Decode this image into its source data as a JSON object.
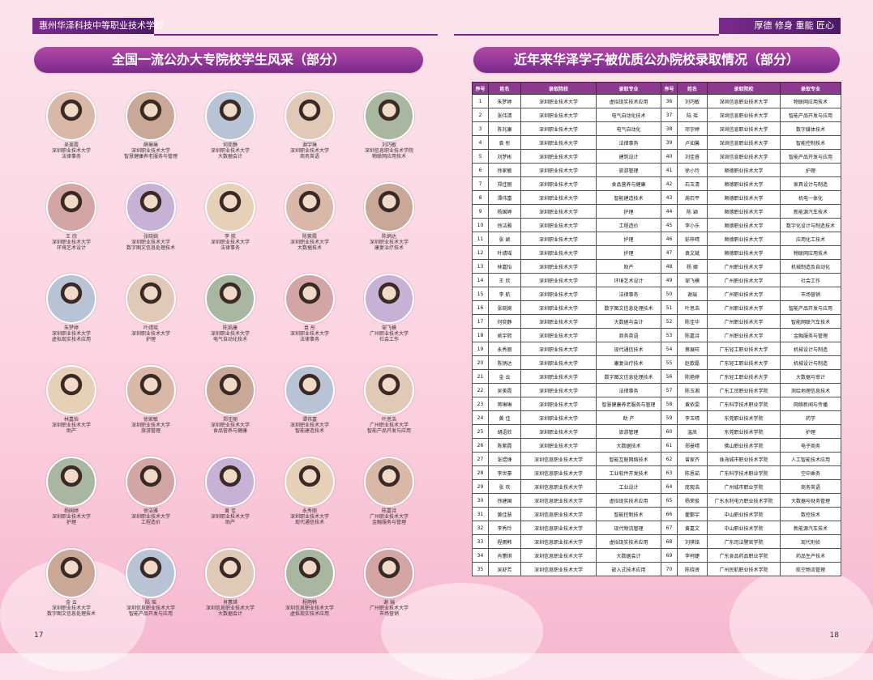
{
  "header": {
    "school": "惠州华泽科技中等职业技术学校",
    "motto": "厚德  修身  重能  匠心"
  },
  "left_title": "全国一流公办大专院校学生风采（部分）",
  "right_title": "近年来华泽学子被优质公办院校录取情况（部分）",
  "students": [
    {
      "name": "吴美霞",
      "school": "深圳职业技术大学",
      "major": "法律事务"
    },
    {
      "name": "薛琳琳",
      "school": "深圳职业技术大学",
      "major": "智慧健康养老服务与管理"
    },
    {
      "name": "何奕静",
      "school": "深圳职业技术大学",
      "major": "大数据会计"
    },
    {
      "name": "谢宇琳",
      "school": "深圳职业技术大学",
      "major": "商务英语"
    },
    {
      "name": "刘巧敏",
      "school": "深圳信息职业技术学院",
      "major": "物联网应用技术"
    },
    {
      "name": "王 欣",
      "school": "深圳职业技术大学",
      "major": "环境艺术设计"
    },
    {
      "name": "张晓婉",
      "school": "深圳职业技术大学",
      "major": "数字图文信息处理技术"
    },
    {
      "name": "李 航",
      "school": "深圳职业技术大学",
      "major": "法律事务"
    },
    {
      "name": "陈紫霞",
      "school": "深圳职业技术大学",
      "major": "大数据技术"
    },
    {
      "name": "陈炳达",
      "school": "深圳职业技术大学",
      "major": "康复治疗技术"
    },
    {
      "name": "朱梦婷",
      "school": "深圳职业技术大学",
      "major": "虚拟现实技术应用"
    },
    {
      "name": "叶靖瑶",
      "school": "深圳职业技术大学",
      "major": "护理"
    },
    {
      "name": "陈焰康",
      "school": "深圳职业技术大学",
      "major": "电气自动化技术"
    },
    {
      "name": "袁 彤",
      "school": "深圳职业技术大学",
      "major": "法律事务"
    },
    {
      "name": "邹飞模",
      "school": "广州职业技术大学",
      "major": "社会工作"
    },
    {
      "name": "林嘉怡",
      "school": "深圳职业技术大学",
      "major": "助产"
    },
    {
      "name": "徐家敏",
      "school": "深圳职业技术大学",
      "major": "旅游管理"
    },
    {
      "name": "郑佳丽",
      "school": "深圳职业技术大学",
      "major": "食品营养与健康"
    },
    {
      "name": "谭伟富",
      "school": "深圳职业技术大学",
      "major": "智能建造技术"
    },
    {
      "name": "叶思浩",
      "school": "广州职业技术大学",
      "major": "智能产品开发与应用"
    },
    {
      "name": "杨国婷",
      "school": "深圳职业技术大学",
      "major": "护理"
    },
    {
      "name": "徐洁雅",
      "school": "深圳职业技术大学",
      "major": "工程造价"
    },
    {
      "name": "黄 佳",
      "school": "深圳职业技术大学",
      "major": "助产"
    },
    {
      "name": "永秀丽",
      "school": "深圳职业技术大学",
      "major": "现代通信技术"
    },
    {
      "name": "陈嘉诗",
      "school": "广州职业技术大学",
      "major": "金融服务与管理"
    },
    {
      "name": "金 云",
      "school": "深圳职业技术大学",
      "major": "数字图文信息处理技术"
    },
    {
      "name": "陆 瑶",
      "school": "深圳信息职业技术大学",
      "major": "智能产品开发与应用"
    },
    {
      "name": "肖蕙琪",
      "school": "深圳信息职业技术大学",
      "major": "大数据会计"
    },
    {
      "name": "程雨韩",
      "school": "深圳信息职业技术大学",
      "major": "虚拟现实技术应用"
    },
    {
      "name": "谢 瑞",
      "school": "广州职业技术大学",
      "major": "市场营销"
    }
  ],
  "table": {
    "headers": [
      "序号",
      "姓名",
      "录取院校",
      "录取专业",
      "序号",
      "姓名",
      "录取院校",
      "录取专业"
    ],
    "rows": [
      [
        "1",
        "朱梦婷",
        "深圳职业技术大学",
        "虚拟现实技术应用",
        "36",
        "刘巧敏",
        "深圳信息职业技术大学",
        "物联网应用技术"
      ],
      [
        "2",
        "张伟清",
        "深圳职业技术大学",
        "电气自动化技术",
        "37",
        "陆 瑶",
        "深圳信息职业技术大学",
        "智能产品开发与应用"
      ],
      [
        "3",
        "陈兆康",
        "深圳职业技术大学",
        "电气自动化",
        "38",
        "邓宇婷",
        "深圳信息职业技术大学",
        "数字媒体技术"
      ],
      [
        "4",
        "袁 彤",
        "深圳职业技术大学",
        "法律事务",
        "39",
        "卢如馨",
        "深圳信息职业技术大学",
        "智能控制技术"
      ],
      [
        "5",
        "刘梦彬",
        "深圳职业技术大学",
        "建筑设计",
        "40",
        "刘佳睿",
        "深圳信息职业技术大学",
        "智能产品开发与应用"
      ],
      [
        "6",
        "徐家敏",
        "深圳职业技术大学",
        "旅游管理",
        "41",
        "徐小玲",
        "顺德职业技术大学",
        "护理"
      ],
      [
        "7",
        "郑佳丽",
        "深圳职业技术大学",
        "食品营养与健康",
        "42",
        "石玉清",
        "顺德职业技术大学",
        "家具设计与制造"
      ],
      [
        "8",
        "谭伟富",
        "深圳职业技术大学",
        "智能建造技术",
        "43",
        "周石平",
        "顺德职业技术大学",
        "机电一体化"
      ],
      [
        "9",
        "杨国婷",
        "深圳职业技术大学",
        "护理",
        "44",
        "陈 颖",
        "顺德职业技术大学",
        "新能源汽车技术"
      ],
      [
        "10",
        "徐洁雅",
        "深圳职业技术大学",
        "工程造价",
        "45",
        "李小乐",
        "顺德职业技术大学",
        "数字化设计与制造技术"
      ],
      [
        "11",
        "张 颖",
        "深圳职业技术大学",
        "护理",
        "46",
        "彭梓晴",
        "顺德职业技术大学",
        "应用化工技术"
      ],
      [
        "12",
        "叶靖瑶",
        "深圳职业技术大学",
        "护理",
        "47",
        "袁文斌",
        "顺德职业技术大学",
        "物联网应用技术"
      ],
      [
        "13",
        "林嘉怡",
        "深圳职业技术大学",
        "助产",
        "48",
        "杨 娜",
        "广州职业技术大学",
        "机械制造及自动化"
      ],
      [
        "14",
        "王 欣",
        "深圳职业技术大学",
        "环境艺术设计",
        "49",
        "邹飞模",
        "广州职业技术大学",
        "社会工作"
      ],
      [
        "15",
        "李 航",
        "深圳职业技术大学",
        "法律事务",
        "50",
        "谢瑞",
        "广州职业技术大学",
        "市场营销"
      ],
      [
        "16",
        "张晓婉",
        "深圳职业技术大学",
        "数字图文信息处理技术",
        "51",
        "叶思浩",
        "广州职业技术大学",
        "智能产品开发与应用"
      ],
      [
        "17",
        "何奕静",
        "深圳职业技术大学",
        "大数据与会计",
        "52",
        "陈佳华",
        "广州职业技术大学",
        "智能网联汽车技术"
      ],
      [
        "18",
        "姚宇熙",
        "深圳职业技术大学",
        "商务英语",
        "53",
        "陈嘉诗",
        "广州职业技术大学",
        "金融服务与管理"
      ],
      [
        "19",
        "永秀丽",
        "深圳职业技术大学",
        "现代通信技术",
        "54",
        "蔡展旺",
        "广东轻工职业技术大学",
        "机械设计与制造"
      ],
      [
        "20",
        "陈炳达",
        "深圳职业技术大学",
        "康复治疗技术",
        "55",
        "赵歆磊",
        "广东轻工职业技术大学",
        "机械设计与制造"
      ],
      [
        "21",
        "金 云",
        "深圳职业技术大学",
        "数字图文信息处理技术",
        "56",
        "陈艳婷",
        "广东轻工职业技术大学",
        "大数据与审计"
      ],
      [
        "22",
        "吴美霞",
        "深圳职业技术大学",
        "法律事务",
        "57",
        "陈玉湘",
        "广东工贸职业技术学院",
        "测绘地理信息技术"
      ],
      [
        "23",
        "蒋琳琳",
        "深圳职业技术大学",
        "智慧健康养老服务与管理",
        "58",
        "黄依雯",
        "广东科学技术职业学院",
        "网络新闻与传播"
      ],
      [
        "24",
        "黄 佳",
        "深圳职业技术大学",
        "助 产",
        "59",
        "李玉晴",
        "东莞职业技术学院",
        "药学"
      ],
      [
        "25",
        "胡语欣",
        "深圳职业技术大学",
        "旅游管理",
        "60",
        "温凤",
        "东莞职业技术学院",
        "护理"
      ],
      [
        "26",
        "陈紫霞",
        "深圳职业技术大学",
        "大数据技术",
        "61",
        "郑曼晴",
        "佛山职业技术学院",
        "电子商务"
      ],
      [
        "27",
        "张煜烽",
        "深圳信息职业技术大学",
        "智能互联网络技术",
        "62",
        "曾家齐",
        "珠海城市职业技术学院",
        "人工智能技术应用"
      ],
      [
        "28",
        "李世豪",
        "深圳信息职业技术大学",
        "工业软件开发技术",
        "63",
        "陈恩茹",
        "广东科学技术职业学院",
        "空中乘务"
      ],
      [
        "29",
        "张 欢",
        "深圳信息职业技术大学",
        "工业设计",
        "64",
        "庞观浩",
        "广州城市职业学院",
        "商务英语"
      ],
      [
        "30",
        "徐建国",
        "深圳信息职业技术大学",
        "虚拟现实技术应用",
        "65",
        "杨荣俊",
        "广东水利电力职业技术学院",
        "大数据与财务管理"
      ],
      [
        "31",
        "黄佳慧",
        "深圳信息职业技术大学",
        "智能控制技术",
        "66",
        "瞿鄞宇",
        "中山职业技术学院",
        "数控技术"
      ],
      [
        "32",
        "李秀玲",
        "深圳信息职业技术大学",
        "现代物流管理",
        "67",
        "黄嘉文",
        "中山职业技术学院",
        "新能源汽车技术"
      ],
      [
        "33",
        "程雨韩",
        "深圳信息职业技术大学",
        "虚拟现实技术应用",
        "68",
        "刘祺铭",
        "广东司法警官学院",
        "现代刑侦"
      ],
      [
        "34",
        "肖蕙琪",
        "深圳信息职业技术大学",
        "大数据会计",
        "69",
        "李柯婕",
        "广东食品药品职业学院",
        "药品生产技术"
      ],
      [
        "35",
        "吴舒芳",
        "深圳信息职业技术大学",
        "嵌入式技术应用",
        "70",
        "陈晓贤",
        "广州民航职业技术学院",
        "航空物流管理"
      ]
    ]
  },
  "page_left": "17",
  "page_right": "18",
  "colors": {
    "accent": "#7a2a8c",
    "table_header": "#8b3a8f",
    "background": "#fcd3e1"
  }
}
